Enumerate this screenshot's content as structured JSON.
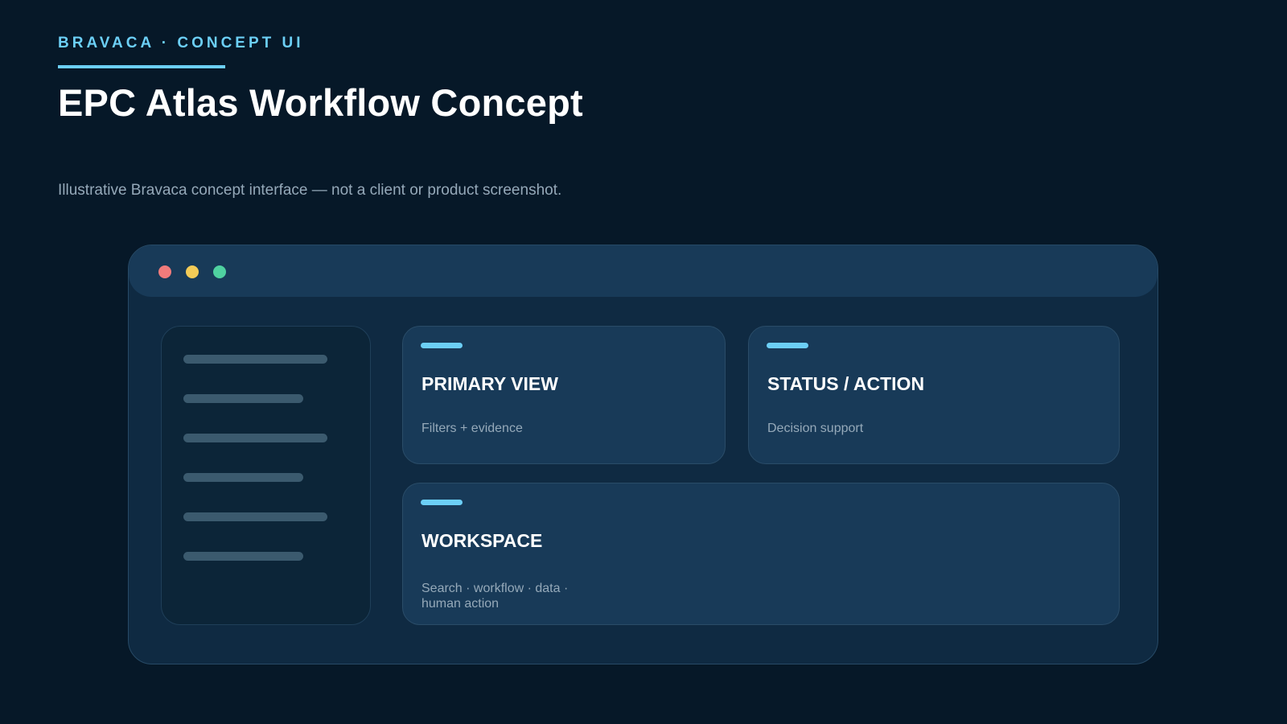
{
  "header": {
    "eyebrow": "BRAVACA · CONCEPT UI",
    "title": "EPC Atlas Workflow Concept",
    "subtitle": "Illustrative Bravaca concept interface — not a client or product screenshot."
  },
  "window": {
    "controls": [
      "close",
      "minimize",
      "maximize"
    ]
  },
  "cards": {
    "primary": {
      "heading": "PRIMARY VIEW",
      "caption": "Filters + evidence"
    },
    "status": {
      "heading": "STATUS / ACTION",
      "caption": "Decision support"
    },
    "workspace": {
      "heading": "WORKSPACE",
      "caption": "Search · workflow · data · human action"
    }
  },
  "colors": {
    "background": "#061828",
    "accent": "#6ccff6",
    "window": "#0f2a42",
    "card": "#183a58",
    "dot_red": "#f07b7b",
    "dot_yellow": "#f3cb57",
    "dot_green": "#4fd1a0"
  }
}
